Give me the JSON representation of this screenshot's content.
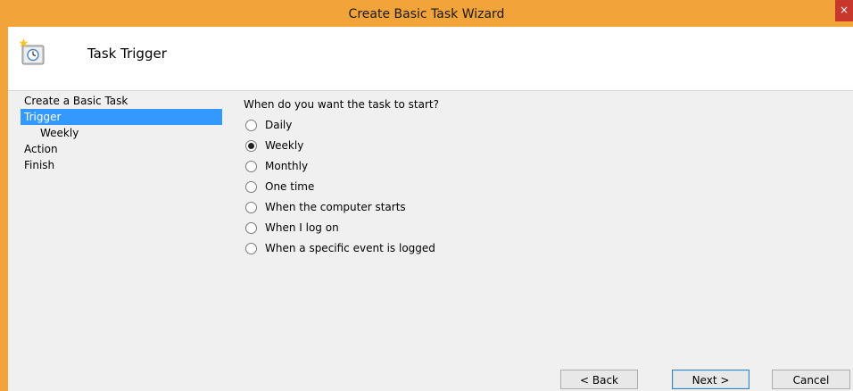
{
  "window": {
    "title": "Create Basic Task Wizard",
    "close_label": "×",
    "accent_color": "#f2a33a"
  },
  "header": {
    "icon": "task-scheduler-icon",
    "title": "Task Trigger"
  },
  "nav": {
    "items": [
      {
        "label": "Create a Basic Task",
        "selected": false,
        "level": 0
      },
      {
        "label": "Trigger",
        "selected": true,
        "level": 0
      },
      {
        "label": "Weekly",
        "selected": false,
        "level": 1
      },
      {
        "label": "Action",
        "selected": false,
        "level": 0
      },
      {
        "label": "Finish",
        "selected": false,
        "level": 0
      }
    ],
    "selection_color": "#3399ff"
  },
  "content": {
    "question": "When do you want the task to start?",
    "options": [
      {
        "label": "Daily",
        "checked": false
      },
      {
        "label": "Weekly",
        "checked": true
      },
      {
        "label": "Monthly",
        "checked": false
      },
      {
        "label": "One time",
        "checked": false
      },
      {
        "label": "When the computer starts",
        "checked": false
      },
      {
        "label": "When I log on",
        "checked": false
      },
      {
        "label": "When a specific event is logged",
        "checked": false
      }
    ]
  },
  "buttons": {
    "back": "< Back",
    "next": "Next >",
    "cancel": "Cancel"
  }
}
